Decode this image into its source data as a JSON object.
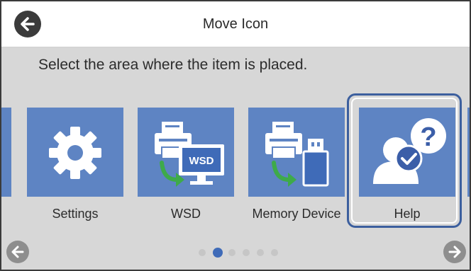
{
  "header": {
    "title": "Move Icon",
    "back_icon": "arrow-left-icon"
  },
  "instruction": "Select the area where the item is placed.",
  "tiles": [
    {
      "label": "Settings",
      "icon": "gear-icon"
    },
    {
      "label": "WSD",
      "icon": "printer-to-monitor-wsd-icon",
      "badge": "WSD"
    },
    {
      "label": "Memory Device",
      "icon": "printer-to-usb-memory-icon"
    },
    {
      "label": "Help",
      "icon": "user-question-check-icon",
      "selected": true
    }
  ],
  "pagination": {
    "page_count": 6,
    "current_page": 2
  },
  "navigation": {
    "prev_icon": "arrow-left-icon",
    "next_icon": "arrow-right-icon"
  },
  "colors": {
    "tile": "#5e84c3",
    "selection": "#3c5f9e",
    "active_dot": "#3f6bb8",
    "background": "#d7d7d7"
  }
}
